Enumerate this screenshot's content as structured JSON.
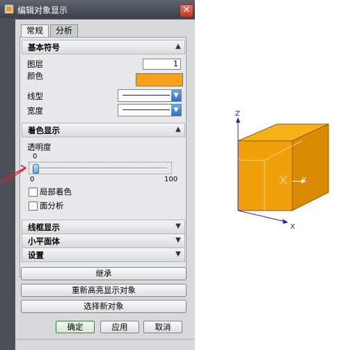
{
  "dialog": {
    "title": "编辑对象显示",
    "close_symbol": "✕",
    "tabs": [
      {
        "label": "常规"
      },
      {
        "label": "分析"
      }
    ],
    "sections": {
      "basic": {
        "label": "基本符号",
        "layer_label": "图层",
        "layer_value": "1",
        "color_label": "颜色",
        "color_value": "#F7A01E",
        "linetype_label": "线型",
        "width_label": "宽度"
      },
      "shading": {
        "label": "着色显示",
        "transparency_label": "透明度",
        "slider_value": "0",
        "slider_min": "0",
        "slider_max": "100",
        "partial_shading_label": "局部着色",
        "face_analysis_label": "面分析"
      },
      "wireframe": {
        "label": "线框显示"
      },
      "facet": {
        "label": "小平面体"
      },
      "settings": {
        "label": "设置"
      }
    },
    "buttons": {
      "inherit": "继承",
      "rehighlight": "重新高亮显示对象",
      "select_new": "选择新对象",
      "ok": "确定",
      "apply": "应用",
      "cancel": "取消"
    }
  },
  "viewport": {
    "axis_z": "Z",
    "axis_y": "Y",
    "axis_x": "X",
    "cube_color": "#F2A20C",
    "axis_color": "#2020C0"
  },
  "annotation": {
    "arrow_color": "#E0202A"
  }
}
